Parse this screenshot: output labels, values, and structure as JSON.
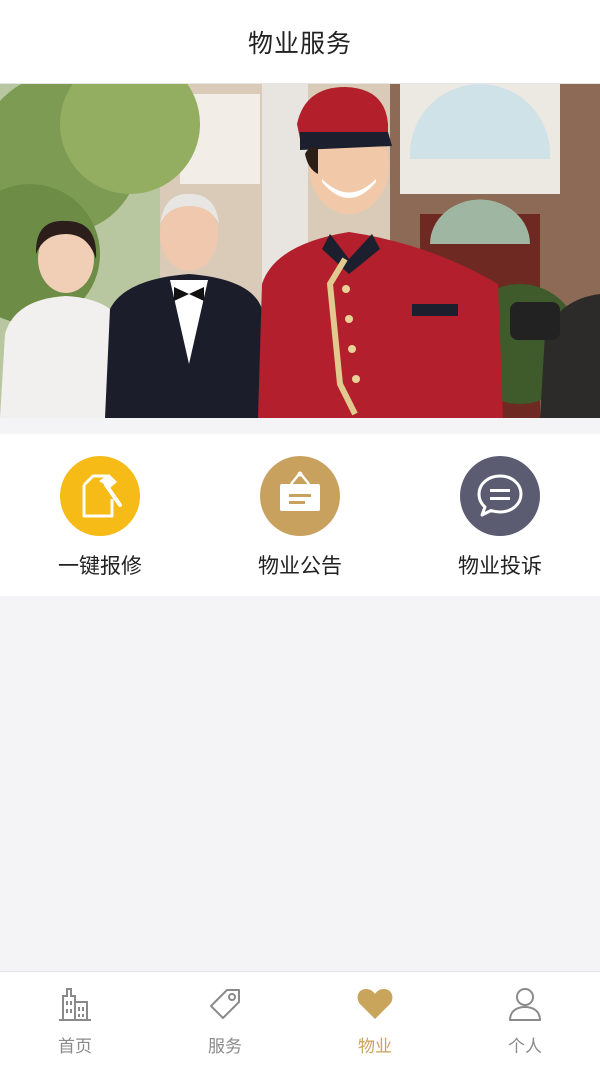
{
  "header": {
    "title": "物业服务"
  },
  "banner": {
    "image": "staff-and-residents-photo"
  },
  "menu": {
    "items": [
      {
        "label": "一键报修",
        "icon": "hammer-icon",
        "color": "#f6bb16"
      },
      {
        "label": "物业公告",
        "icon": "notice-board-icon",
        "color": "#c9a15f"
      },
      {
        "label": "物业投诉",
        "icon": "chat-bubble-icon",
        "color": "#5b5c72"
      }
    ]
  },
  "tabbar": {
    "items": [
      {
        "label": "首页",
        "icon": "building-icon",
        "active": false
      },
      {
        "label": "服务",
        "icon": "tag-icon",
        "active": false
      },
      {
        "label": "物业",
        "icon": "heart-icon",
        "active": true
      },
      {
        "label": "个人",
        "icon": "person-icon",
        "active": false
      }
    ],
    "active_color": "#c9a45b",
    "inactive_color": "#8a8a8a"
  }
}
